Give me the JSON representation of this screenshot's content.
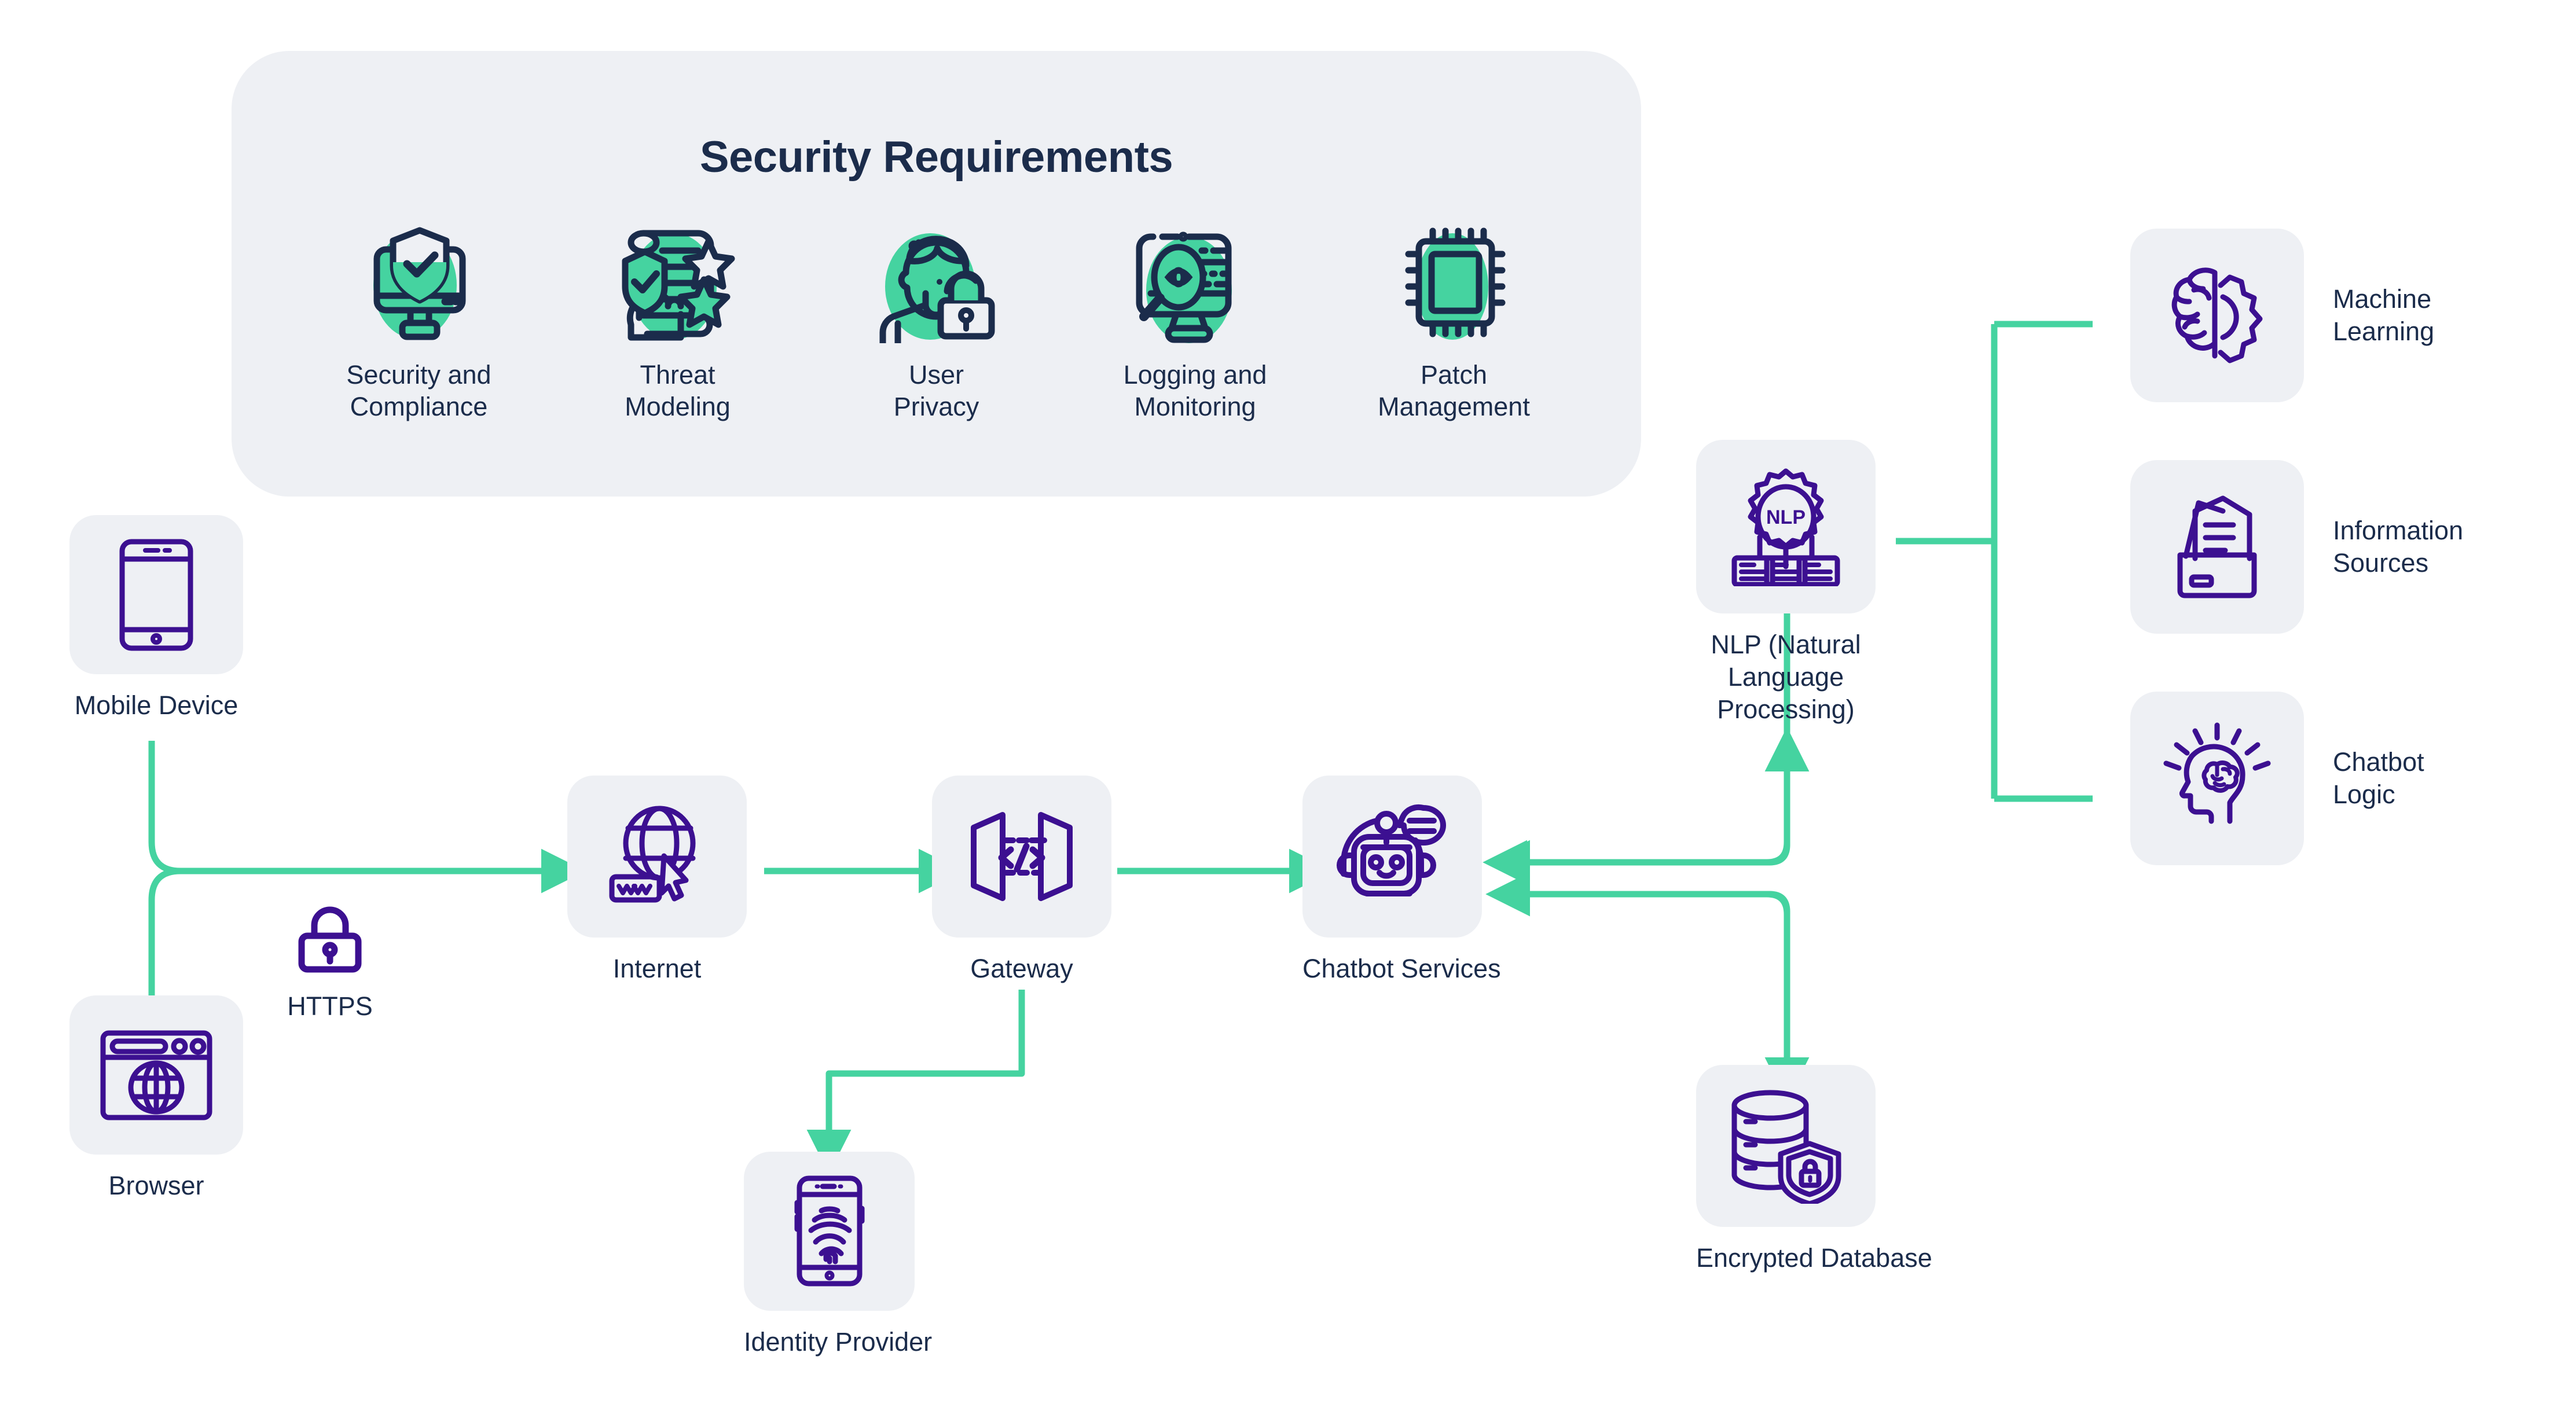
{
  "colors": {
    "panel_bg": "#eef0f4",
    "tile_bg": "#eef0f4",
    "text": "#1b2c4b",
    "icon_purple": "#3c1091",
    "icon_navy": "#1b2c4b",
    "accent_green": "#45d3a0",
    "arrow_green": "#45d3a0",
    "page_bg": "#ffffff"
  },
  "security_panel": {
    "title": "Security Requirements",
    "items": [
      {
        "label": "Security and\nCompliance",
        "icon": "shield-monitor-check-icon"
      },
      {
        "label": "Threat\nModeling",
        "icon": "scroll-stars-hand-icon"
      },
      {
        "label": "User\nPrivacy",
        "icon": "user-padlock-icon"
      },
      {
        "label": "Logging and\nMonitoring",
        "icon": "monitor-magnifier-eye-icon"
      },
      {
        "label": "Patch\nManagement",
        "icon": "microchip-icon"
      }
    ]
  },
  "nodes": {
    "mobile_device": {
      "label": "Mobile Device",
      "icon": "tablet-icon"
    },
    "browser": {
      "label": "Browser",
      "icon": "browser-globe-icon"
    },
    "https": {
      "label": "HTTPS",
      "icon": "padlock-icon"
    },
    "internet": {
      "label": "Internet",
      "icon": "globe-www-cursor-icon"
    },
    "gateway": {
      "label": "Gateway",
      "icon": "api-gateway-code-icon"
    },
    "chatbot_services": {
      "label": "Chatbot Services",
      "icon": "robot-chat-icon"
    },
    "identity_provider": {
      "label": "Identity Provider",
      "icon": "phone-fingerprint-icon"
    },
    "nlp": {
      "label": "NLP (Natural\nLanguage\nProcessing)",
      "icon": "nlp-gear-nodes-icon"
    },
    "encrypted_database": {
      "label": "Encrypted Database",
      "icon": "database-shield-lock-icon"
    },
    "machine_learning": {
      "label": "Machine\nLearning",
      "icon": "brain-gear-icon"
    },
    "information_sources": {
      "label": "Information\nSources",
      "icon": "folder-documents-icon"
    },
    "chatbot_logic": {
      "label": "Chatbot\nLogic",
      "icon": "head-brain-idea-icon"
    }
  },
  "flows": [
    {
      "from": "mobile_device",
      "to": "internet",
      "style": "merge-arrow"
    },
    {
      "from": "browser",
      "to": "internet",
      "style": "merge-arrow"
    },
    {
      "from": "internet",
      "to": "gateway",
      "style": "arrow"
    },
    {
      "from": "gateway",
      "to": "chatbot_services",
      "style": "arrow"
    },
    {
      "from": "gateway",
      "to": "identity_provider",
      "style": "arrow"
    },
    {
      "from": "nlp",
      "to": "chatbot_services",
      "style": "arrow"
    },
    {
      "from": "encrypted_database",
      "to": "chatbot_services",
      "style": "arrow"
    },
    {
      "from": "chatbot_services",
      "to": "nlp",
      "style": "arrow"
    },
    {
      "from": "chatbot_services",
      "to": "encrypted_database",
      "style": "arrow"
    },
    {
      "from": "nlp",
      "to": "machine_learning",
      "style": "bracket"
    },
    {
      "from": "nlp",
      "to": "information_sources",
      "style": "bracket"
    },
    {
      "from": "nlp",
      "to": "chatbot_logic",
      "style": "bracket"
    }
  ]
}
